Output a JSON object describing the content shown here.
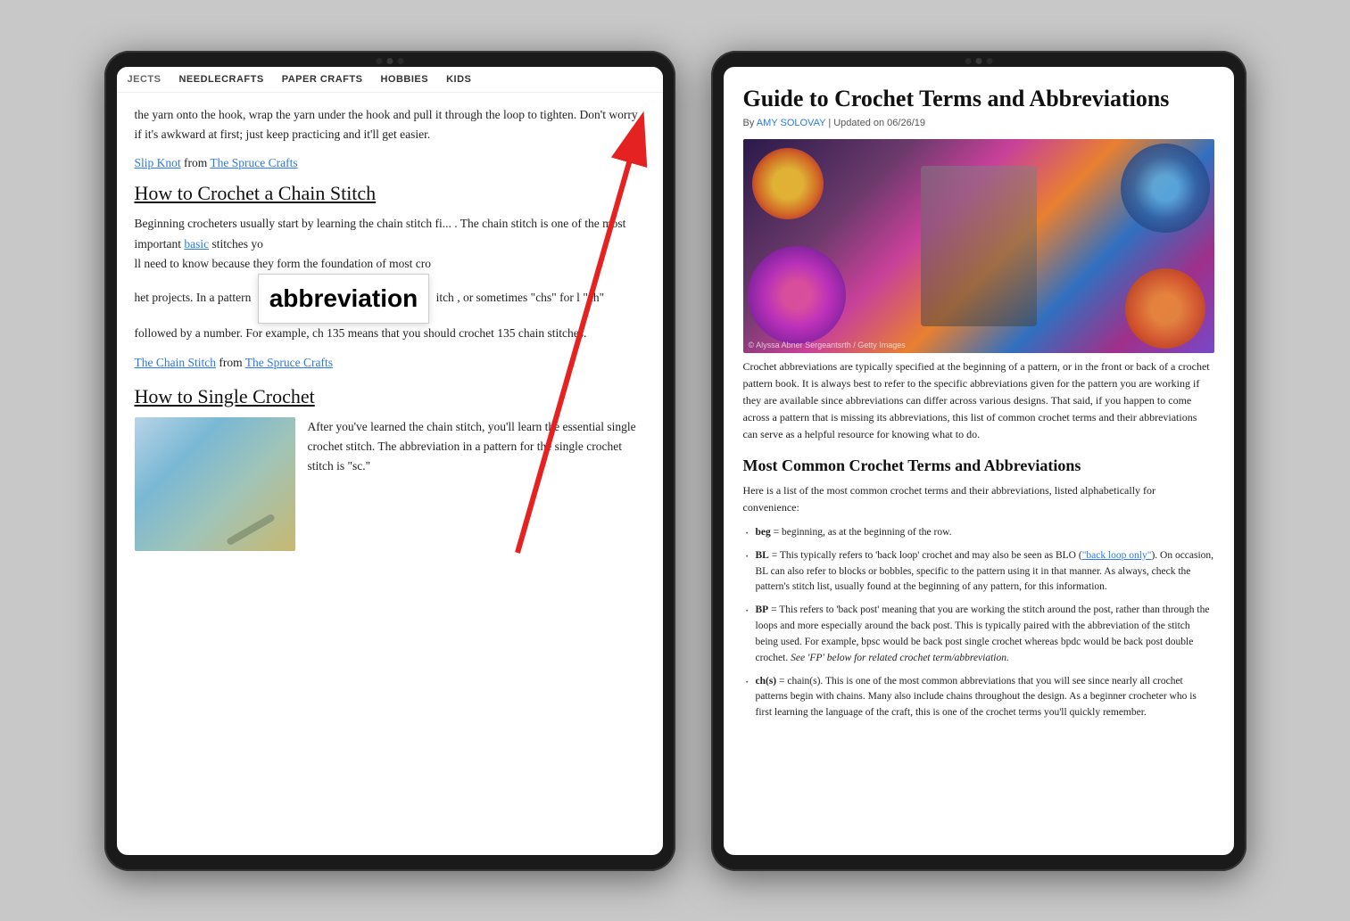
{
  "left_tablet": {
    "camera_dots": 3,
    "nav": {
      "items": [
        "JECTS",
        "NEEDLECRAFTS",
        "PAPER CRAFTS",
        "HOBBIES",
        "KIDS"
      ]
    },
    "article": {
      "intro_text": "the yarn onto the hook, wrap the yarn under the hook and pull it through the loop to tighten. Don't worry if it's awkward at first; just keep practicing and it'll get easier.",
      "slip_knot_link": "Slip Knot",
      "from_text1": "from",
      "spruce_link1": "The Spruce Crafts",
      "section1_heading": "How to Crochet a Chain Stitch",
      "section1_body1": "Beginning crocheters usually start by learning the chain stitch fi",
      "section1_body2": ". The chain stitch is one of the most important",
      "basic_link": "basic",
      "section1_body3": "stitches yo",
      "section1_body4": "ll need to know because they form the foundation of most cro",
      "section1_body5": "het projects. In a pattern",
      "section1_body6": "itch",
      "section1_body7": ", or sometimes \"chs\" for l",
      "section1_body8": "\"ch\" followed by a number. For example, ch 135 means that you should crochet 135 chain stitches.",
      "tooltip_word": "abbreviation",
      "chain_link": "The Chain Stitch",
      "from_text2": "from",
      "spruce_link2": "The Spruce Crafts",
      "section2_heading": "How to Single Crochet",
      "section2_body": "After you've learned the chain stitch, you'll learn the essential single crochet stitch. The abbreviation in a pattern for the single crochet stitch is \"sc.\""
    }
  },
  "right_tablet": {
    "camera_dots": 3,
    "article": {
      "title": "Guide to Crochet Terms and Abbreviations",
      "byline": "By",
      "author": "AMY SOLOVAY",
      "updated": "Updated on 06/26/19",
      "hero_credit": "© Alyssa Abner Sergeantsrth / Getty Images",
      "body_text": "Crochet abbreviations are typically specified at the beginning of a pattern, or in the front or back of a crochet pattern book. It is always best to refer to the specific abbreviations given for the pattern you are working if they are available since abbreviations can differ across various designs. That said, if you happen to come across a pattern that is missing its abbreviations, this list of common crochet terms and their abbreviations can serve as a helpful resource for knowing what to do.",
      "subheading": "Most Common Crochet Terms and Abbreviations",
      "intro": "Here is a list of the most common crochet terms and their abbreviations, listed alphabetically for convenience:",
      "terms": [
        {
          "term": "beg",
          "definition": "= beginning, as at the beginning of the row."
        },
        {
          "term": "BL",
          "definition": "= This typically refers to 'back loop' crochet and may also be seen as BLO (\"back loop only\"). On occasion, BL can also refer to blocks or bobbles, specific to the pattern using it in that manner. As always, check the pattern's stitch list, usually found at the beginning of any pattern, for this information."
        },
        {
          "term": "BP",
          "definition": "= This refers to 'back post' meaning that you are working the stitch around the post, rather than through the loops and more especially around the back post. This is typically paired with the abbreviation of the stitch being used. For example, bpsc would be back post single crochet whereas bpdc would be back post double crochet. See 'FP' below for related crochet term/abbreviation."
        },
        {
          "term": "ch(s)",
          "definition": "= chain(s). This is one of the most common abbreviations that you will see since nearly all crochet patterns begin with chains. Many also include chains throughout the design. As a beginner crocheter who is first learning the language of the craft, this is one of the crochet terms you'll quickly remember."
        }
      ]
    }
  },
  "arrow": {
    "color": "#e52222"
  }
}
